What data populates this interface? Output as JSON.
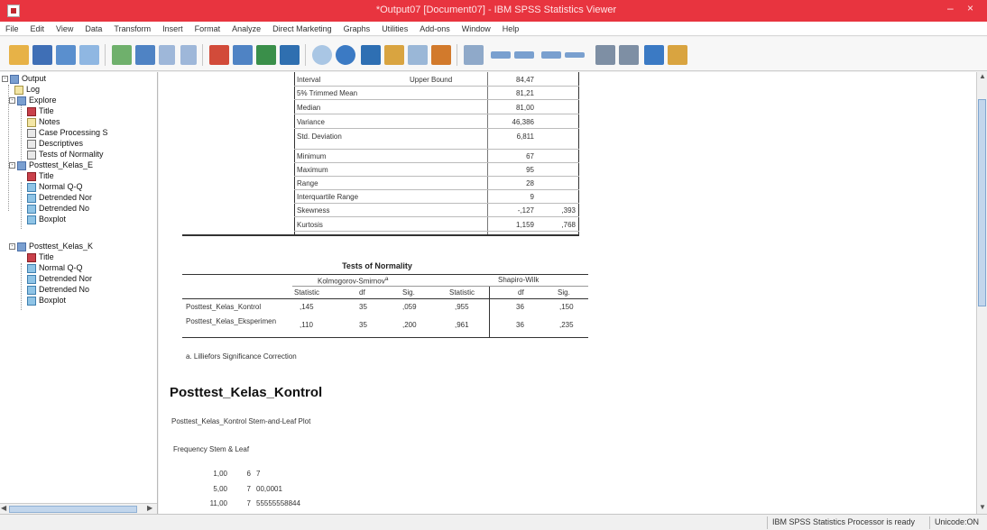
{
  "window": {
    "title": "*Output07 [Document07] - IBM SPSS Statistics Viewer"
  },
  "menu": [
    "File",
    "Edit",
    "View",
    "Data",
    "Transform",
    "Insert",
    "Format",
    "Analyze",
    "Direct Marketing",
    "Graphs",
    "Utilities",
    "Add-ons",
    "Window",
    "Help"
  ],
  "toolbar": {
    "icons": [
      "open-icon",
      "save-icon",
      "print-icon",
      "print-preview-icon",
      "export-icon",
      "recall-dialog-icon",
      "undo-icon",
      "redo-icon",
      "goto-data-icon",
      "goto-case-icon",
      "goto-variable-icon",
      "variables-icon",
      "spell-check-icon",
      "script-icon",
      "designate-window-icon",
      "select-last-output-icon",
      "show-all-icon",
      "hide-icon",
      "promote-icon",
      "demote-icon",
      "expand-icon",
      "collapse-icon",
      "show-icon",
      "hide-selected-icon",
      "insert-heading-icon",
      "insert-title-icon",
      "insert-text-icon"
    ]
  },
  "tree": {
    "items": [
      {
        "label": "Output",
        "level": 0,
        "icon": "book"
      },
      {
        "label": "Log",
        "level": 1,
        "icon": "note"
      },
      {
        "label": "Explore",
        "level": 1,
        "icon": "book"
      },
      {
        "label": "Title",
        "level": 2,
        "icon": "red"
      },
      {
        "label": "Notes",
        "level": 2,
        "icon": "note"
      },
      {
        "label": "Case Processing S",
        "level": 2,
        "icon": "table"
      },
      {
        "label": "Descriptives",
        "level": 2,
        "icon": "table"
      },
      {
        "label": "Tests of Normality",
        "level": 2,
        "icon": "table"
      },
      {
        "label": "Posttest_Kelas_E",
        "level": 1,
        "icon": "book"
      },
      {
        "label": "Title",
        "level": 2,
        "icon": "red"
      },
      {
        "label": "Normal Q-Q",
        "level": 2,
        "icon": "chart"
      },
      {
        "label": "Detrended Nor",
        "level": 2,
        "icon": "chart"
      },
      {
        "label": "Detrended No",
        "level": 2,
        "icon": "chart"
      },
      {
        "label": "Boxplot",
        "level": 2,
        "icon": "chart"
      },
      {
        "label": "Posttest_Kelas_K",
        "level": 1,
        "icon": "book"
      },
      {
        "label": "Title",
        "level": 2,
        "icon": "red"
      },
      {
        "label": "Normal Q-Q",
        "level": 2,
        "icon": "chart"
      },
      {
        "label": "Detrended Nor",
        "level": 2,
        "icon": "chart"
      },
      {
        "label": "Detrended No",
        "level": 2,
        "icon": "chart"
      },
      {
        "label": "Boxplot",
        "level": 2,
        "icon": "chart"
      }
    ]
  },
  "descriptives": {
    "rows": [
      {
        "label": "Interval",
        "sub": "Upper Bound",
        "v1": "84,47",
        "v2": ""
      },
      {
        "label": "5% Trimmed Mean",
        "sub": "",
        "v1": "81,21",
        "v2": ""
      },
      {
        "label": "Median",
        "sub": "",
        "v1": "81,00",
        "v2": ""
      },
      {
        "label": "Variance",
        "sub": "",
        "v1": "46,386",
        "v2": ""
      },
      {
        "label": "Std. Deviation",
        "sub": "",
        "v1": "6,811",
        "v2": ""
      },
      {
        "label": "Minimum",
        "sub": "",
        "v1": "67",
        "v2": ""
      },
      {
        "label": "Maximum",
        "sub": "",
        "v1": "95",
        "v2": ""
      },
      {
        "label": "Range",
        "sub": "",
        "v1": "28",
        "v2": ""
      },
      {
        "label": "Interquartile Range",
        "sub": "",
        "v1": "9",
        "v2": ""
      },
      {
        "label": "Skewness",
        "sub": "",
        "v1": "-,127",
        "v2": ",393"
      },
      {
        "label": "Kurtosis",
        "sub": "",
        "v1": "1,159",
        "v2": ",768"
      }
    ]
  },
  "normality": {
    "title": "Tests of Normality",
    "group1": "Kolmogorov-Smirnov",
    "group1_sup": "a",
    "group2": "Shapiro-Wilk",
    "headers": [
      "Statistic",
      "df",
      "Sig.",
      "Statistic",
      "df",
      "Sig."
    ],
    "rows": [
      {
        "label": "Posttest_Kelas_Kontrol",
        "values": [
          ",145",
          "35",
          ",059",
          ",955",
          "36",
          ",150"
        ]
      },
      {
        "label": "Posttest_Kelas_Eksperimen",
        "values": [
          ",110",
          "35",
          ",200",
          ",961",
          "36",
          ",235"
        ]
      }
    ],
    "note": "a. Lilliefors Significance Correction"
  },
  "section": {
    "title": "Posttest_Kelas_Kontrol",
    "warning": "Posttest_Kelas_Kontrol Stem-and-Leaf Plot",
    "freq_header": "Frequency    Stem &  Leaf",
    "freq_rows": [
      {
        "freq": "1,00",
        "stem": "6",
        "leaf": "7"
      },
      {
        "freq": "5,00",
        "stem": "7",
        "leaf": "00,0001"
      },
      {
        "freq": "11,00",
        "stem": "7",
        "leaf": "55555558844"
      }
    ]
  },
  "status": {
    "processor": "IBM SPSS Statistics Processor is ready",
    "encoding": "Unicode:ON"
  }
}
